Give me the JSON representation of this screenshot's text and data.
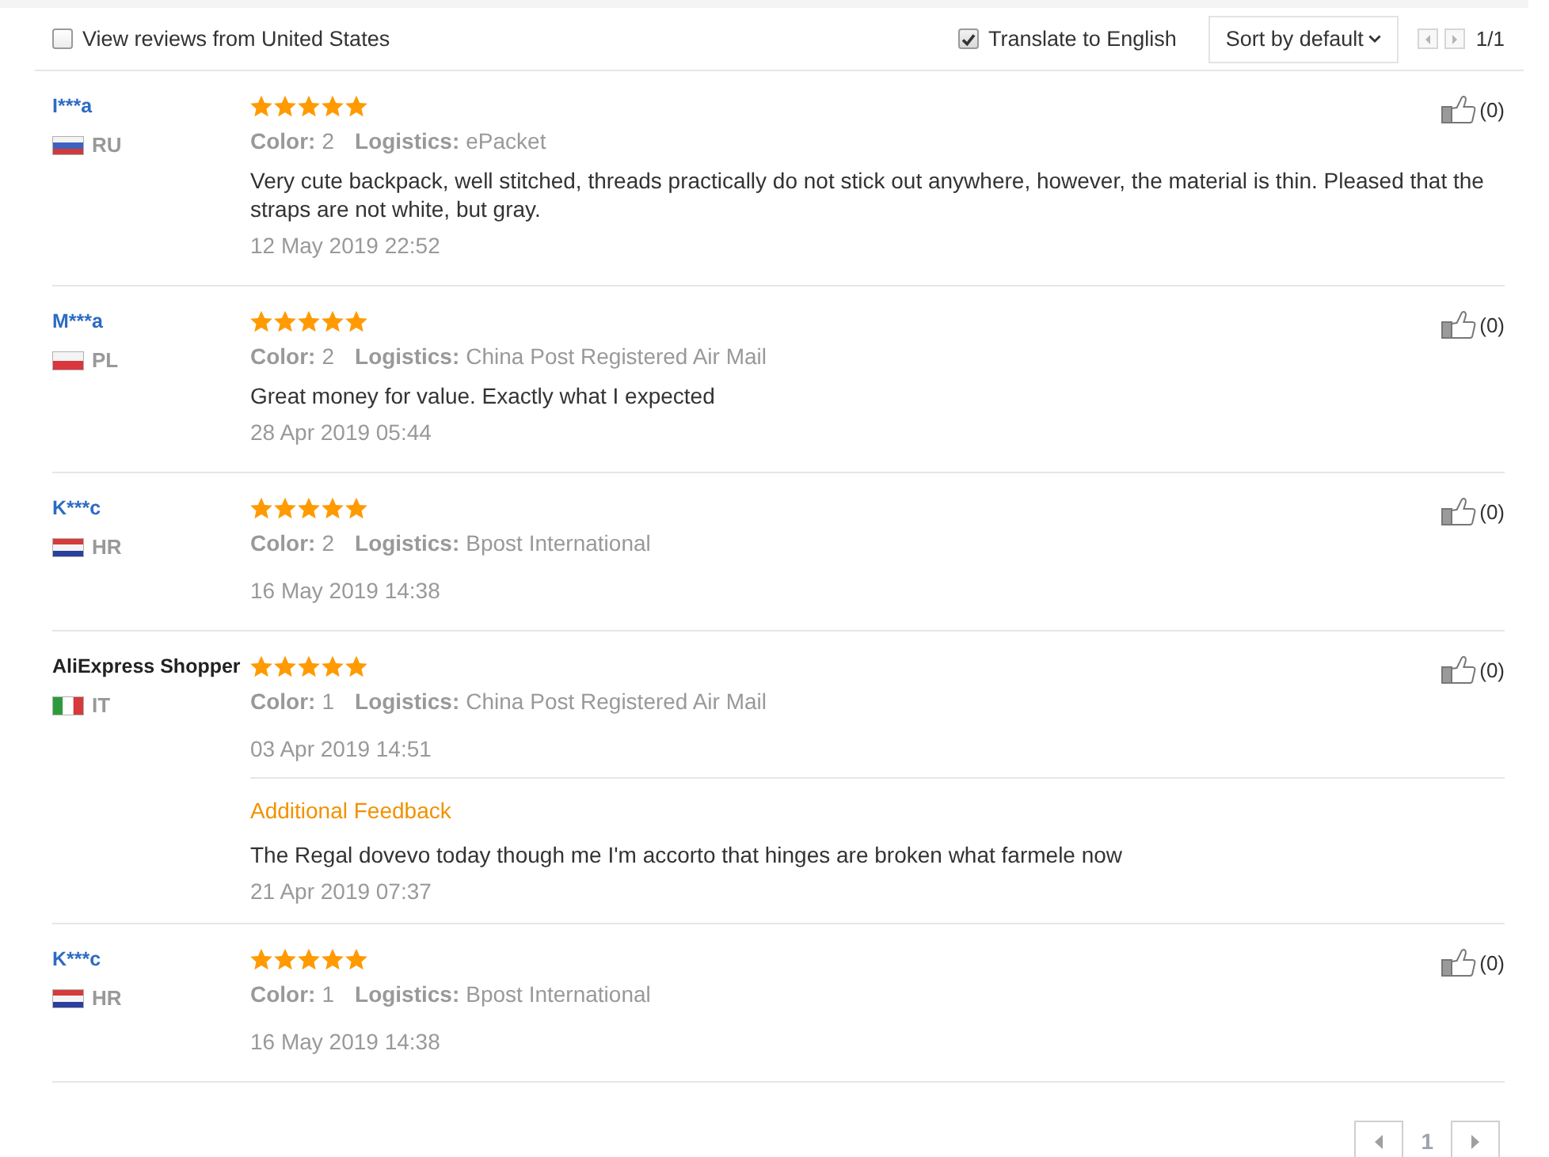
{
  "filter": {
    "label": "View reviews from United States",
    "checked": false
  },
  "translate": {
    "label": "Translate to English",
    "checked": true
  },
  "sort": {
    "label": "Sort by default"
  },
  "pager": {
    "text": "1/1"
  },
  "reviews": [
    {
      "name": "I***a",
      "linked": true,
      "country": "RU",
      "flag": {
        "kind": "horizontal",
        "stripes": [
          {
            "color": "#f4f4f4"
          },
          {
            "color": "#3d62c0"
          },
          {
            "color": "#cf3b3b"
          }
        ]
      },
      "stars": 5,
      "attributes": [
        {
          "label": "Color:",
          "value": "2"
        },
        {
          "label": "Logistics:",
          "value": "ePacket"
        }
      ],
      "text": "Very cute backpack, well stitched, threads practically do not stick out anywhere, however, the material is thin. Pleased that the straps are not white, but gray.",
      "date": "12 May 2019 22:52",
      "likes": "(0)"
    },
    {
      "name": "M***a",
      "linked": true,
      "country": "PL",
      "flag": {
        "kind": "horizontal",
        "stripes": [
          {
            "color": "#f4f4f4"
          },
          {
            "color": "#d9363e"
          }
        ]
      },
      "stars": 5,
      "attributes": [
        {
          "label": "Color:",
          "value": "2"
        },
        {
          "label": "Logistics:",
          "value": "China Post Registered Air Mail"
        }
      ],
      "text": "Great money for value. Exactly what I expected",
      "date": "28 Apr 2019 05:44",
      "likes": "(0)"
    },
    {
      "name": "K***c",
      "linked": true,
      "country": "HR",
      "flag": {
        "kind": "horizontal",
        "stripes": [
          {
            "color": "#d63a3a"
          },
          {
            "color": "#f4f4f4"
          },
          {
            "color": "#2b3f9e"
          }
        ]
      },
      "stars": 5,
      "attributes": [
        {
          "label": "Color:",
          "value": "2"
        },
        {
          "label": "Logistics:",
          "value": "Bpost International"
        }
      ],
      "date": "16 May 2019 14:38",
      "likes": "(0)"
    },
    {
      "name": "AliExpress Shopper",
      "linked": false,
      "country": "IT",
      "flag": {
        "kind": "vertical",
        "stripes": [
          {
            "color": "#2e9a3e"
          },
          {
            "color": "#ffffff"
          },
          {
            "color": "#d63a3a"
          }
        ]
      },
      "stars": 5,
      "attributes": [
        {
          "label": "Color:",
          "value": "1"
        },
        {
          "label": "Logistics:",
          "value": "China Post Registered Air Mail"
        }
      ],
      "date": "03 Apr 2019 14:51",
      "likes": "(0)",
      "additional_feedback": {
        "title": "Additional Feedback",
        "text": "The Regal dovevo today though me I'm accorto that hinges are broken what farmele now",
        "date": "21 Apr 2019 07:37"
      }
    },
    {
      "name": "K***c",
      "linked": true,
      "country": "HR",
      "flag": {
        "kind": "horizontal",
        "stripes": [
          {
            "color": "#d63a3a"
          },
          {
            "color": "#f4f4f4"
          },
          {
            "color": "#2b3f9e"
          }
        ]
      },
      "stars": 5,
      "attributes": [
        {
          "label": "Color:",
          "value": "1"
        },
        {
          "label": "Logistics:",
          "value": "Bpost International"
        }
      ],
      "date": "16 May 2019 14:38",
      "likes": "(0)"
    }
  ],
  "pagination": {
    "pages": [
      {
        "label": "1",
        "selected": true
      }
    ]
  }
}
